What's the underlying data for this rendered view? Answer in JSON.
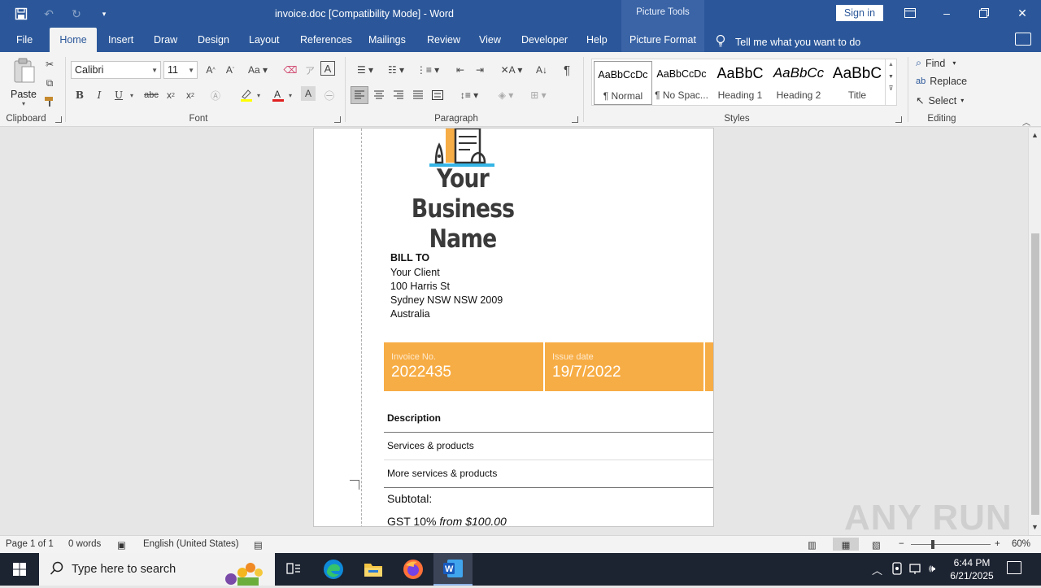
{
  "window": {
    "title": "invoice.doc [Compatibility Mode]  -  Word",
    "context_tools": "Picture Tools",
    "sign_in": "Sign in"
  },
  "tabs": [
    "File",
    "Home",
    "Insert",
    "Draw",
    "Design",
    "Layout",
    "References",
    "Mailings",
    "Review",
    "View",
    "Developer",
    "Help",
    "Picture Format"
  ],
  "tell_me": "Tell me what you want to do",
  "ribbon": {
    "clipboard": {
      "paste": "Paste",
      "label": "Clipboard"
    },
    "font": {
      "name": "Calibri",
      "size": "11",
      "label": "Font",
      "bold": "B",
      "italic": "I",
      "underline": "U",
      "strike": "abc"
    },
    "paragraph": {
      "label": "Paragraph"
    },
    "styles": {
      "label": "Styles",
      "items": [
        {
          "sample": "AaBbCcDc",
          "name": "¶ Normal"
        },
        {
          "sample": "AaBbCcDc",
          "name": "¶ No Spac..."
        },
        {
          "sample": "AaBbC",
          "name": "Heading 1"
        },
        {
          "sample": "AaBbCc",
          "name": "Heading 2"
        },
        {
          "sample": "AaBbC",
          "name": "Title"
        }
      ]
    },
    "editing": {
      "label": "Editing",
      "find": "Find",
      "replace": "Replace",
      "select": "Select"
    }
  },
  "document": {
    "business_name": "Your Business Name",
    "bill_to": {
      "heading": "BILL TO",
      "lines": [
        "Your Client",
        "100 Harris St",
        "Sydney NSW NSW 2009",
        "Australia"
      ]
    },
    "invoice_no_label": "Invoice No.",
    "invoice_no": "2022435",
    "issue_date_label": "Issue date",
    "issue_date": "19/7/2022",
    "table": {
      "header": "Description",
      "rows": [
        "Services & products",
        "More services & products"
      ]
    },
    "subtotal_label": "Subtotal:",
    "gst_label": "GST 10%",
    "gst_from": "from $100.00"
  },
  "status": {
    "page": "Page 1 of 1",
    "words": "0 words",
    "language": "English (United States)",
    "zoom": "60%"
  },
  "taskbar": {
    "search_placeholder": "Type here to search",
    "time": "6:44 PM",
    "date": "6/21/2025"
  },
  "watermark": "ANY RUN",
  "colors": {
    "word_blue": "#2b579a",
    "invoice_band": "#f7ad45"
  }
}
